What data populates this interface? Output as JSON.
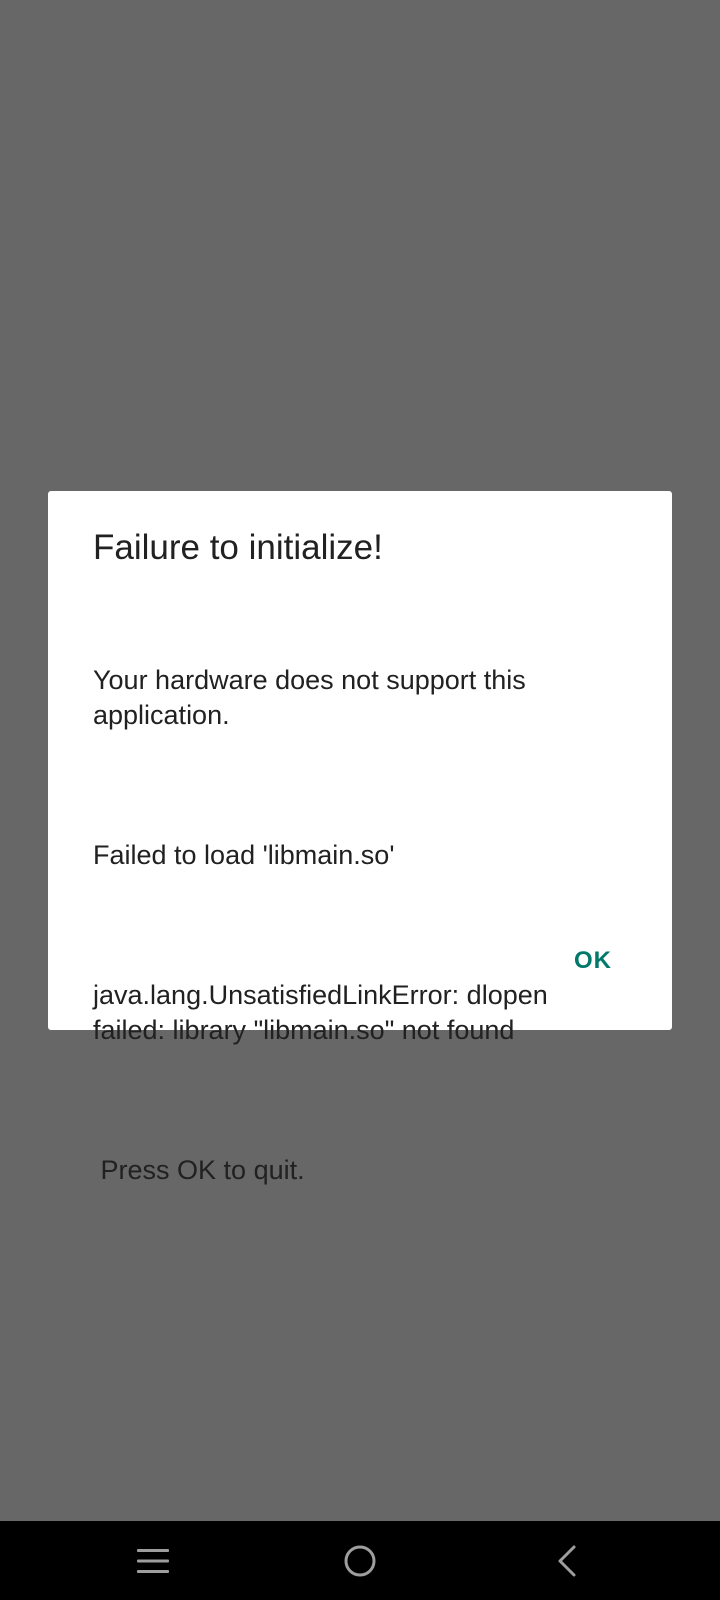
{
  "dialog": {
    "title": "Failure to initialize!",
    "message_lines": [
      "Your hardware does not support this application.",
      "Failed to load 'libmain.so'",
      "java.lang.UnsatisfiedLinkError: dlopen failed: library \"libmain.so\" not found",
      " Press OK to quit."
    ],
    "ok_label": "OK"
  },
  "navbar": {
    "menu_icon": "menu-icon",
    "home_icon": "home-icon",
    "back_icon": "back-icon"
  },
  "colors": {
    "scrim": "#676767",
    "dialog_bg": "#ffffff",
    "text": "#212121",
    "accent": "#00796b",
    "navbar_bg": "#000000",
    "nav_icon": "#9e9e9e"
  }
}
